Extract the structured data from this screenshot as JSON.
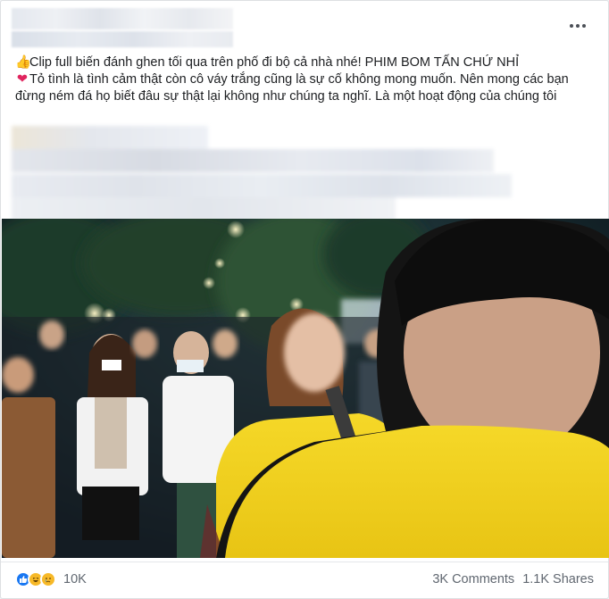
{
  "post": {
    "line1_text": "Clip full biến đánh ghen tối qua trên phố đi bộ cả nhà nhé! PHIM BOM TẤN CHỨ NHỈ",
    "line2_text": "Tỏ tình là tình cảm thật còn cô váy trắng cũng là sự cố không mong muốn. Nên mong các bạn đừng ném đá họ biết đâu sự thật lại không như chúng ta nghĩ. Là một hoạt động của chúng tôi",
    "thumb_glyph": "👍",
    "heart_glyph": "❤"
  },
  "header": {
    "more_glyph": "•••"
  },
  "footer": {
    "reaction_count": "10K",
    "comments": "3K Comments",
    "shares": "1.1K Shares"
  },
  "colors": {
    "like_blue": "#1877f2",
    "shirt_yellow": "#f3d21a",
    "text": "#1c1e21",
    "secondary_text": "#606770"
  },
  "icons": [
    "more-options-icon",
    "like-reaction-icon",
    "haha-reaction-icon",
    "sad-reaction-icon"
  ]
}
